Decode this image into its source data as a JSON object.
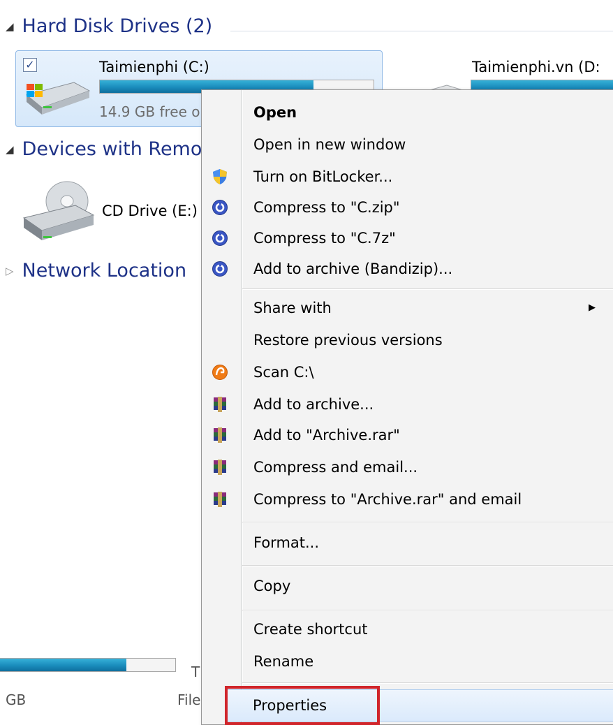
{
  "sections": {
    "hard_disk": "Hard Disk Drives (2)",
    "removable": "Devices with Remo",
    "network": "Network Location"
  },
  "drives": {
    "c": {
      "name": "Taimienphi (C:)",
      "free": "14.9 GB free o",
      "used_fraction": 0.78,
      "checkbox": "✓"
    },
    "d": {
      "name": "Taimienphi.vn  (D:"
    },
    "e": {
      "name": "CD Drive (E:)"
    }
  },
  "bottom": {
    "gb": "GB",
    "file": "File",
    "t": "T",
    "used_fraction": 0.72
  },
  "context_menu": {
    "items": [
      {
        "label": "Open"
      },
      {
        "label": "Open in new window"
      },
      {
        "label": "Turn on BitLocker...",
        "icon": "shield-icon"
      },
      {
        "label": "Compress to \"C.zip\"",
        "icon": "bandizip-icon"
      },
      {
        "label": "Compress to \"C.7z\"",
        "icon": "bandizip-icon"
      },
      {
        "label": "Add to archive (Bandizip)...",
        "icon": "bandizip-icon"
      },
      {
        "label": "Share with",
        "submenu_arrow": "▶"
      },
      {
        "label": "Restore previous versions"
      },
      {
        "label": "Scan C:\\",
        "icon": "avast-icon"
      },
      {
        "label": "Add to archive...",
        "icon": "winrar-icon"
      },
      {
        "label": "Add to \"Archive.rar\"",
        "icon": "winrar-icon"
      },
      {
        "label": "Compress and email...",
        "icon": "winrar-icon"
      },
      {
        "label": "Compress to \"Archive.rar\" and email",
        "icon": "winrar-icon"
      },
      {
        "label": "Format..."
      },
      {
        "label": "Copy"
      },
      {
        "label": "Create shortcut"
      },
      {
        "label": "Rename"
      },
      {
        "label": "Properties"
      }
    ]
  },
  "colors": {
    "highlight": "#d0252b",
    "header_text": "#1e3287"
  }
}
